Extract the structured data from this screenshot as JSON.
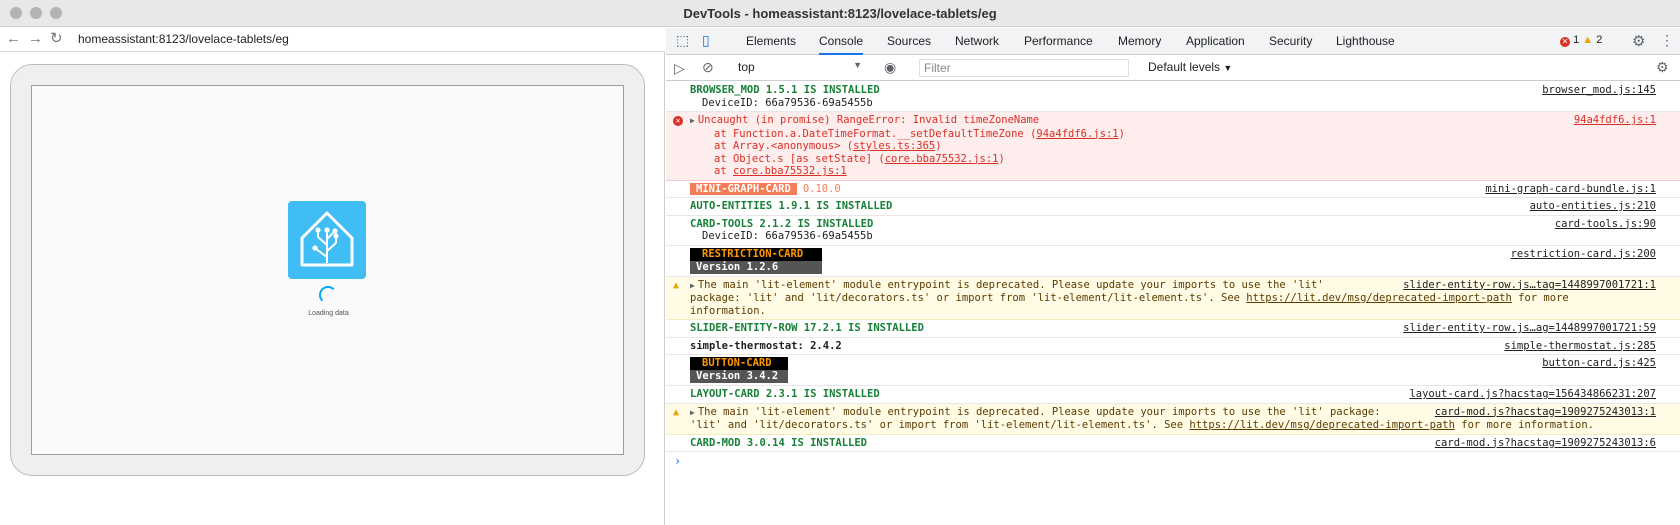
{
  "window": {
    "title": "DevTools - homeassistant:8123/lovelace-tablets/eg"
  },
  "browser": {
    "url": "homeassistant:8123/lovelace-tablets/eg",
    "loading_text": "Loading data"
  },
  "devtools": {
    "tabs": [
      "Elements",
      "Console",
      "Sources",
      "Network",
      "Performance",
      "Memory",
      "Application",
      "Security",
      "Lighthouse"
    ],
    "active_tab": "Console",
    "error_count": "1",
    "warning_count": "2",
    "context": "top",
    "filter_placeholder": "Filter",
    "levels": "Default levels"
  },
  "console": {
    "browser_mod": {
      "text": "BROWSER_MOD 1.5.1 IS INSTALLED",
      "sub": "DeviceID: 66a79536-69a5455b",
      "src": "browser_mod.js:145"
    },
    "error": {
      "line1": "Uncaught (in promise) RangeError: Invalid timeZoneName",
      "src": "94a4fdf6.js:1",
      "at1_pre": "at Function.a.DateTimeFormat.__setDefaultTimeZone (",
      "at1_link": "94a4fdf6.js:1",
      "at2_pre": "at Array.<anonymous> (",
      "at2_link": "styles.ts:365",
      "at3_pre": "at Object.s [as setState] (",
      "at3_link": "core.bba75532.js:1",
      "at4_pre": "at ",
      "at4_link": "core.bba75532.js:1",
      "close": ")"
    },
    "mini_graph": {
      "badge": "MINI-GRAPH-CARD",
      "version": "0.10.0",
      "src": "mini-graph-card-bundle.js:1"
    },
    "auto_entities": {
      "text": "AUTO-ENTITIES 1.9.1 IS INSTALLED",
      "src": "auto-entities.js:210"
    },
    "card_tools": {
      "text": "CARD-TOOLS 2.1.2 IS INSTALLED",
      "sub": "DeviceID: 66a79536-69a5455b",
      "src": "card-tools.js:90"
    },
    "restriction": {
      "badge": "RESTRICTION-CARD",
      "version": "Version 1.2.6",
      "src": "restriction-card.js:200"
    },
    "warn1": {
      "line1": "The main 'lit-element' module entrypoint is deprecated. Please update your imports to use the 'lit'",
      "line2_pre": "package: 'lit' and 'lit/decorators.ts' or import from 'lit-element/lit-element.ts'. See ",
      "link": "https://lit.dev/msg/deprecated-import-path",
      "line2_post": " for more",
      "line3": "information.",
      "src": "slider-entity-row.js…tag=1448997001721:1"
    },
    "slider": {
      "text": "SLIDER-ENTITY-ROW 17.2.1 IS INSTALLED",
      "src": "slider-entity-row.js…ag=1448997001721:59"
    },
    "thermostat": {
      "text": "simple-thermostat: 2.4.2",
      "src": "simple-thermostat.js:285"
    },
    "button_card": {
      "badge": "BUTTON-CARD",
      "version": "Version 3.4.2",
      "src": "button-card.js:425"
    },
    "layout_card": {
      "text": "LAYOUT-CARD 2.3.1 IS INSTALLED",
      "src": "layout-card.js?hacstag=156434866231:207"
    },
    "warn2": {
      "line1": "The main 'lit-element' module entrypoint is deprecated. Please update your imports to use the 'lit' package:",
      "line2_pre": "'lit' and 'lit/decorators.ts' or import from 'lit-element/lit-element.ts'. See ",
      "link": "https://lit.dev/msg/deprecated-import-path",
      "line2_post": " for more information.",
      "src": "card-mod.js?hacstag=1909275243013:1"
    },
    "card_mod": {
      "text": "CARD-MOD 3.0.14 IS INSTALLED",
      "src": "card-mod.js?hacstag=1909275243013:6"
    },
    "prompt": "›"
  }
}
